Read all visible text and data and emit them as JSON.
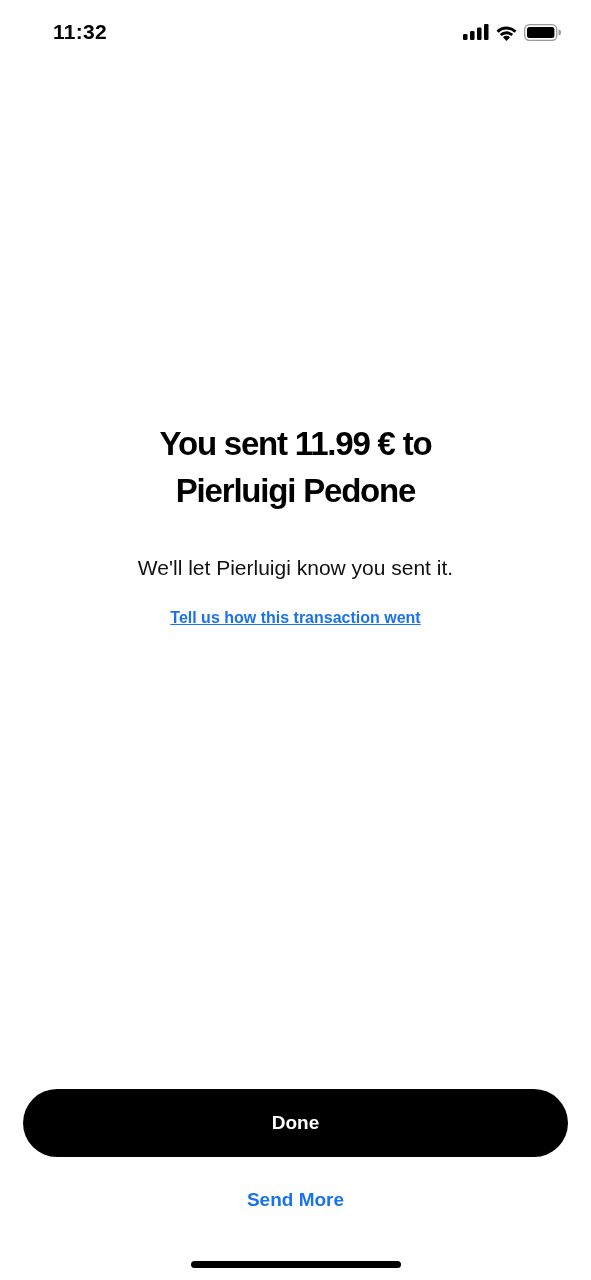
{
  "status_bar": {
    "time": "11:32"
  },
  "title": "You sent 11.99 € to Pierluigi Pedone",
  "message": "We'll let Pierluigi know you sent it.",
  "feedback_link": "Tell us how this transaction went",
  "buttons": {
    "primary": "Done",
    "secondary": "Send More"
  }
}
